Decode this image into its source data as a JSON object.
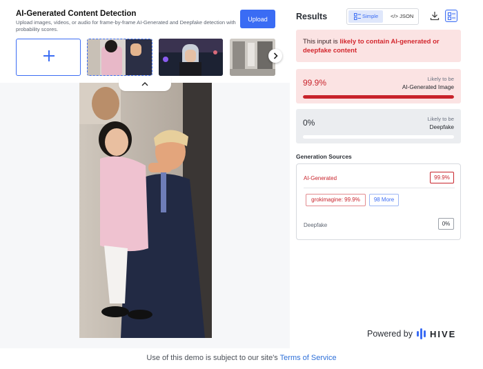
{
  "header": {
    "title": "AI-Generated Content Detection",
    "subtitle": "Upload images, videos, or audio for frame-by-frame AI-Generated and Deepfake detection with probability scores.",
    "upload_label": "Upload"
  },
  "thumbnails": [
    "add-media",
    "photo-girl-and-man",
    "photo-cyberpunk-woman",
    "photo-interior"
  ],
  "results": {
    "title": "Results",
    "view_simple": "Simple",
    "view_json": "</> JSON",
    "verdict_prefix": "This input is ",
    "verdict_highlight": "likely to contain AI-generated or deepfake content",
    "ai_score": {
      "value": "99.9%",
      "fraction": 0.999,
      "small": "Likely to be",
      "label": "AI-Generated Image"
    },
    "deepfake_score": {
      "value": "0%",
      "fraction": 0.0,
      "small": "Likely to be",
      "label": "Deepfake"
    },
    "sources_title": "Generation Sources",
    "sources": {
      "ai_label": "AI-Generated",
      "ai_value": "99.9%",
      "top_source": "grokimagine: 99.9%",
      "more": "98 More",
      "deepfake_label": "Deepfake",
      "deepfake_value": "0%"
    }
  },
  "branding": {
    "powered_by": "Powered by",
    "brand": "HIVE"
  },
  "footer": {
    "text": "Use of this demo is subject to our site's ",
    "link": "Terms of Service"
  },
  "colors": {
    "accent": "#3a6cf4",
    "danger": "#c8232b",
    "danger_bg": "#fbe3e3"
  }
}
